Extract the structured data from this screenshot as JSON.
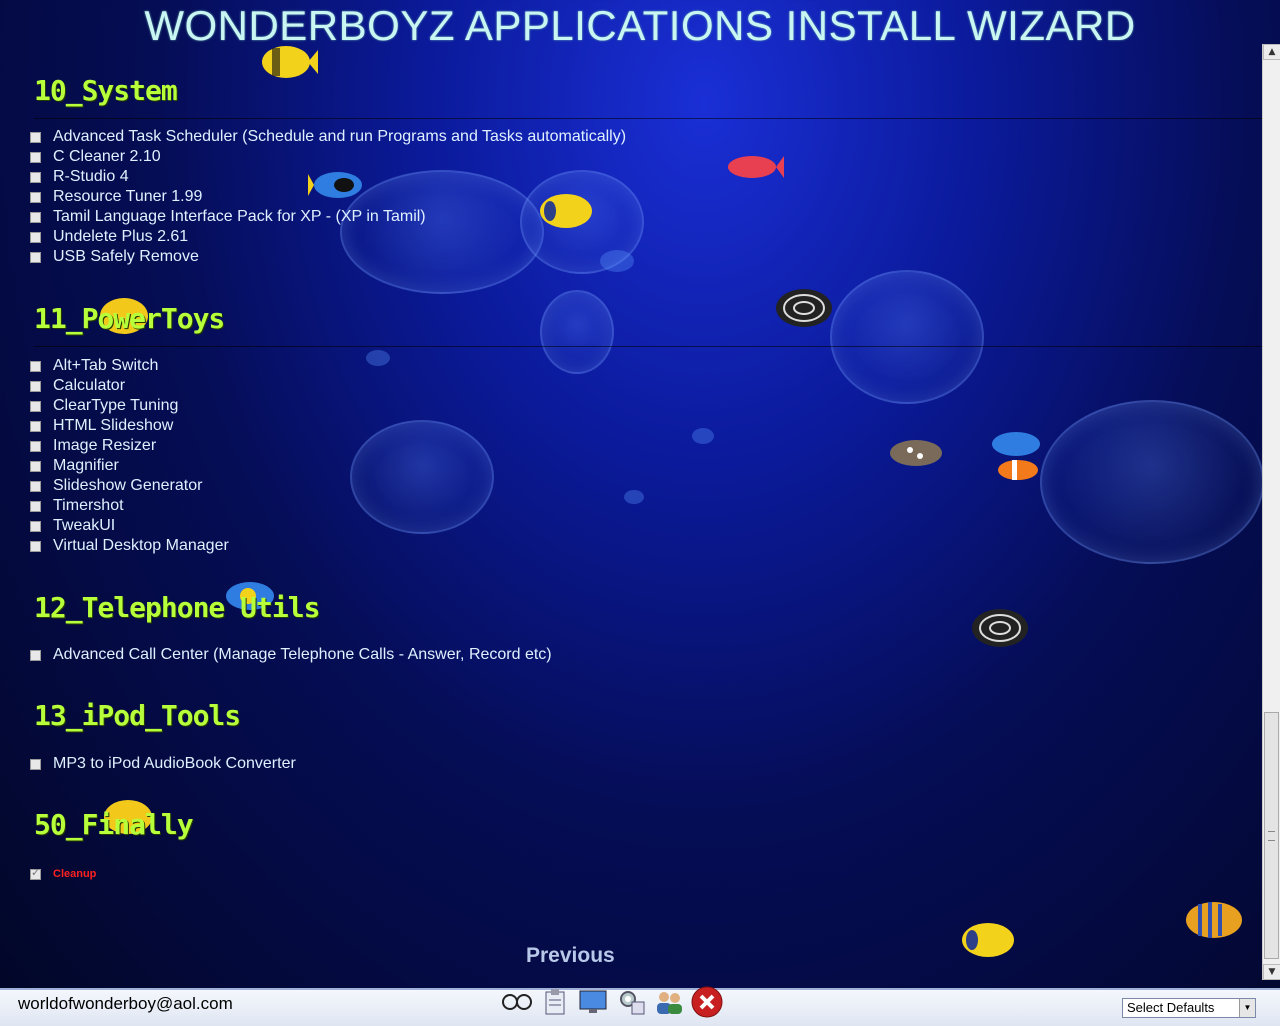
{
  "title": "WONDERBOYZ APPLICATIONS INSTALL WIZARD",
  "sections": [
    {
      "title": "10_System",
      "items": [
        {
          "label": "Advanced Task Scheduler (Schedule and run Programs and Tasks automatically)",
          "checked": false
        },
        {
          "label": "C Cleaner 2.10",
          "checked": false
        },
        {
          "label": "R-Studio 4",
          "checked": false
        },
        {
          "label": "Resource Tuner 1.99",
          "checked": false
        },
        {
          "label": "Tamil Language Interface Pack for XP - (XP in Tamil)",
          "checked": false
        },
        {
          "label": "Undelete Plus 2.61",
          "checked": false
        },
        {
          "label": "USB Safely Remove",
          "checked": false
        }
      ]
    },
    {
      "title": "11_PowerToys",
      "items": [
        {
          "label": "Alt+Tab Switch",
          "checked": false
        },
        {
          "label": "Calculator",
          "checked": false
        },
        {
          "label": "ClearType Tuning",
          "checked": false
        },
        {
          "label": "HTML Slideshow",
          "checked": false
        },
        {
          "label": "Image Resizer",
          "checked": false
        },
        {
          "label": "Magnifier",
          "checked": false
        },
        {
          "label": "Slideshow Generator",
          "checked": false
        },
        {
          "label": "Timershot",
          "checked": false
        },
        {
          "label": "TweakUI",
          "checked": false
        },
        {
          "label": "Virtual Desktop Manager",
          "checked": false
        }
      ]
    },
    {
      "title": "12_Telephone Utils",
      "items": [
        {
          "label": "Advanced Call Center (Manage Telephone Calls - Answer, Record etc)",
          "checked": false
        }
      ]
    },
    {
      "title": "13_iPod_Tools",
      "items": [
        {
          "label": "MP3 to iPod AudioBook Converter",
          "checked": false
        }
      ]
    },
    {
      "title": "50_Finally",
      "items": [
        {
          "label": "Cleanup",
          "checked": true,
          "disabled": true
        }
      ]
    }
  ],
  "previous_label": "Previous",
  "footer": {
    "email": "worldofwonderboy@aol.com",
    "toolbar_icons": [
      "glasses-icon",
      "clipboard-icon",
      "monitor-icon",
      "settings-icon",
      "users-icon",
      "close-icon"
    ],
    "defaults_select": "Select Defaults"
  },
  "colors": {
    "section_title": "#b7ff3a",
    "item_text": "#dff0ff",
    "cleanup_text": "#ff2020",
    "title_text": "#c9f6f3"
  }
}
